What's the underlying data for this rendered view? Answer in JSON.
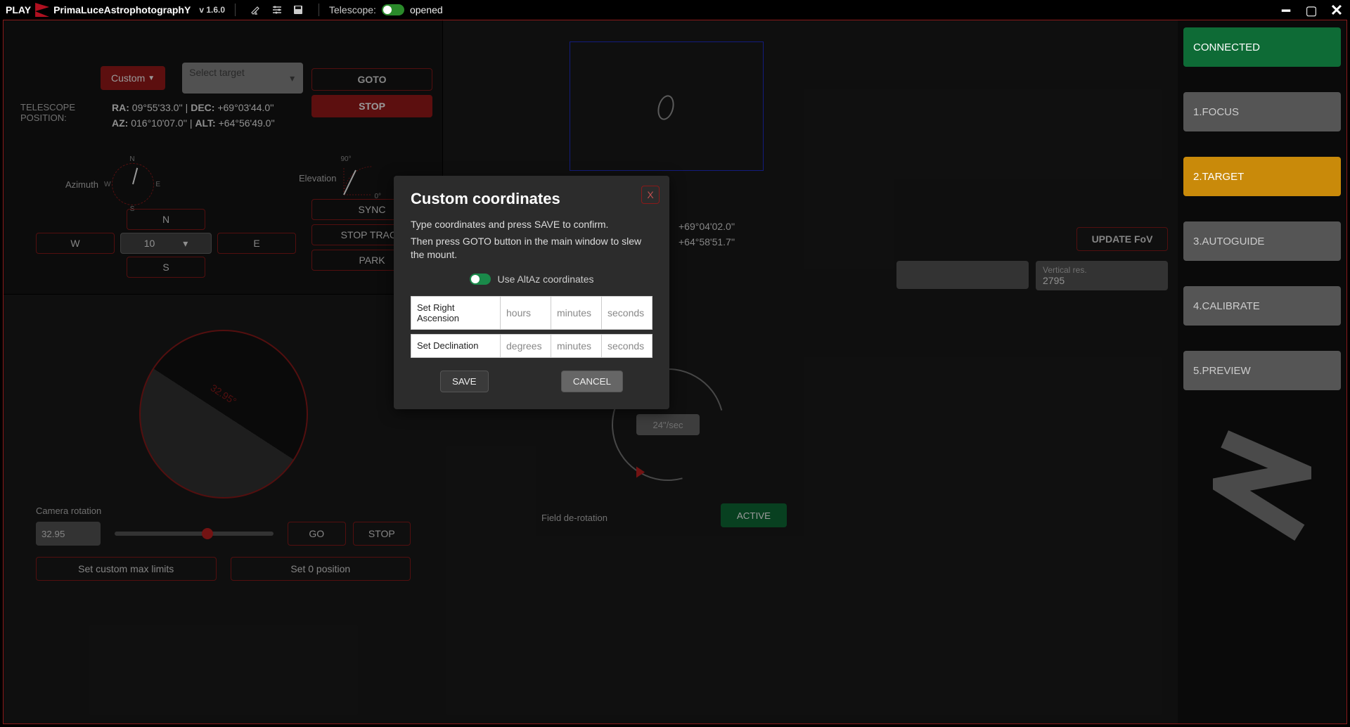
{
  "topbar": {
    "brand_play": "PLAY",
    "brand_name": "PrimaLuceAstrophotographY",
    "version": "v 1.6.0",
    "telescope_label": "Telescope:",
    "status": "opened"
  },
  "nav": {
    "connected": "CONNECTED",
    "items": [
      "1.FOCUS",
      "2.TARGET",
      "3.AUTOGUIDE",
      "4.CALIBRATE",
      "5.PREVIEW"
    ],
    "active_index": 1
  },
  "telescope_panel": {
    "custom_btn": "Custom",
    "target_placeholder": "Select target",
    "goto": "GOTO",
    "stop": "STOP",
    "pos_label_1": "TELESCOPE",
    "pos_label_2": "POSITION:",
    "ra_label": "RA:",
    "ra_val": "09°55'33.0''",
    "dec_label": "DEC:",
    "dec_val": "+69°03'44.0''",
    "az_label": "AZ:",
    "az_val": "016°10'07.0''",
    "alt_label": "ALT:",
    "alt_val": "+64°56'49.0''",
    "azimuth_label": "Azimuth",
    "elevation_label": "Elevation",
    "compass": {
      "n": "N",
      "s": "S",
      "e": "E",
      "w": "W"
    },
    "elev_top": "90°",
    "elev_bot": "0°",
    "dir": {
      "n": "N",
      "s": "S",
      "e": "E",
      "w": "W",
      "speed": "10"
    },
    "sync": "SYNC",
    "stop_track": "STOP TRACK",
    "park": "PARK"
  },
  "fov_panel": {
    "dec_coord": "+69°04'02.0''",
    "alt_coord": "+64°58'51.7''",
    "update_fov": "UPDATE FoV",
    "vres_label": "Vertical res.",
    "vres_val": "2795"
  },
  "rotator": {
    "angle_text": "32.95°",
    "label": "Camera rotation",
    "value": "32.95",
    "go": "GO",
    "stop": "STOP",
    "set_limits": "Set custom max limits",
    "set_zero": "Set 0 position"
  },
  "derotator": {
    "speed": "24\"/sec",
    "label": "Field de-rotation",
    "active": "ACTIVE"
  },
  "modal": {
    "title": "Custom coordinates",
    "close": "X",
    "line1": "Type coordinates and press SAVE to confirm.",
    "line2": "Then press GOTO button in the main window to slew the mount.",
    "toggle_label": "Use AltAz coordinates",
    "ra_label": "Set Right Ascension",
    "dec_label": "Set Declination",
    "ph_hours": "hours",
    "ph_degrees": "degrees",
    "ph_minutes": "minutes",
    "ph_seconds": "seconds",
    "save": "SAVE",
    "cancel": "CANCEL"
  }
}
